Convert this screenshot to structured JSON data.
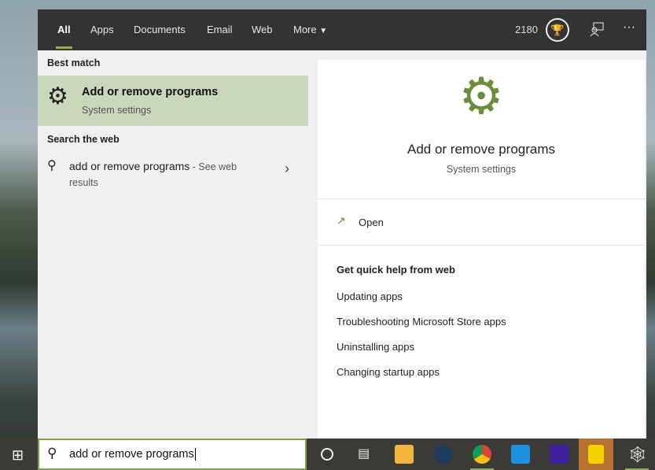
{
  "header": {
    "tabs": [
      "All",
      "Apps",
      "Documents",
      "Email",
      "Web",
      "More"
    ],
    "points": "2180",
    "icons": [
      "trophy-icon",
      "feedback-icon",
      "more-icon"
    ]
  },
  "left": {
    "best_match_label": "Best match",
    "best_title": "Add or remove programs",
    "best_sub": "System settings",
    "search_web_label": "Search the web",
    "web_query": "add or remove programs",
    "web_suffix": " - See web",
    "web_suffix2": "results"
  },
  "right": {
    "title": "Add or remove programs",
    "sub": "System settings",
    "open": "Open",
    "help_heading": "Get quick help from web",
    "links": [
      "Updating apps",
      "Troubleshooting Microsoft Store apps",
      "Uninstalling apps",
      "Changing startup apps"
    ]
  },
  "taskbar": {
    "search_value": "add or remove programs",
    "apps": [
      "cortana",
      "task-view",
      "file-explorer",
      "steam",
      "chrome",
      "mail",
      "amazon-music",
      "sticky-notes",
      "spider-app"
    ]
  },
  "colors": {
    "accent": "#8ab04a",
    "icon_green": "#6b8e3e",
    "header": "#333333"
  }
}
